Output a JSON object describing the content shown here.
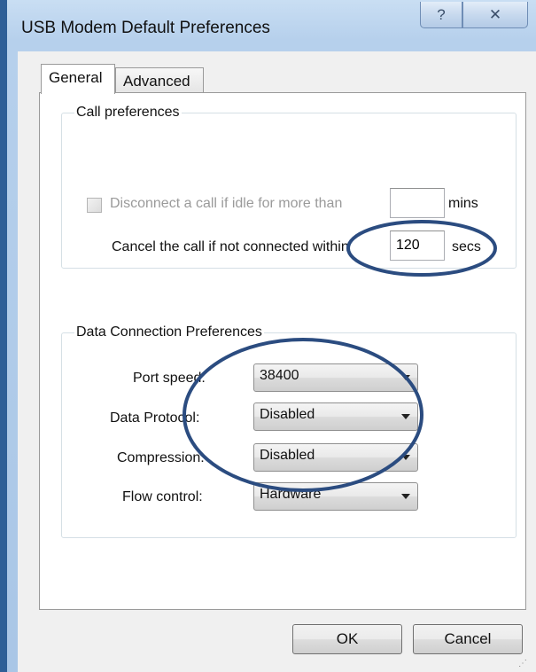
{
  "window": {
    "title": "USB Modem Default Preferences",
    "help_glyph": "?",
    "close_glyph": "✕"
  },
  "tabs": [
    {
      "label": "General",
      "selected": true
    },
    {
      "label": "Advanced",
      "selected": false
    }
  ],
  "call_preferences": {
    "legend": "Call preferences",
    "disconnect_label": "Disconnect a call if idle for more than",
    "disconnect_checked": false,
    "disconnect_enabled": false,
    "idle_value": "",
    "idle_unit": "mins",
    "cancel_label": "Cancel the call if not connected within",
    "cancel_value": "120",
    "cancel_unit": "secs"
  },
  "data_connection": {
    "legend": "Data Connection Preferences",
    "port_speed_label": "Port speed:",
    "port_speed_value": "38400",
    "data_protocol_label": "Data Protocol:",
    "data_protocol_value": "Disabled",
    "compression_label": "Compression:",
    "compression_value": "Disabled",
    "flow_control_label": "Flow control:",
    "flow_control_value": "Hardware"
  },
  "buttons": {
    "ok": "OK",
    "cancel": "Cancel"
  },
  "annotation_color": "#2b4c80"
}
